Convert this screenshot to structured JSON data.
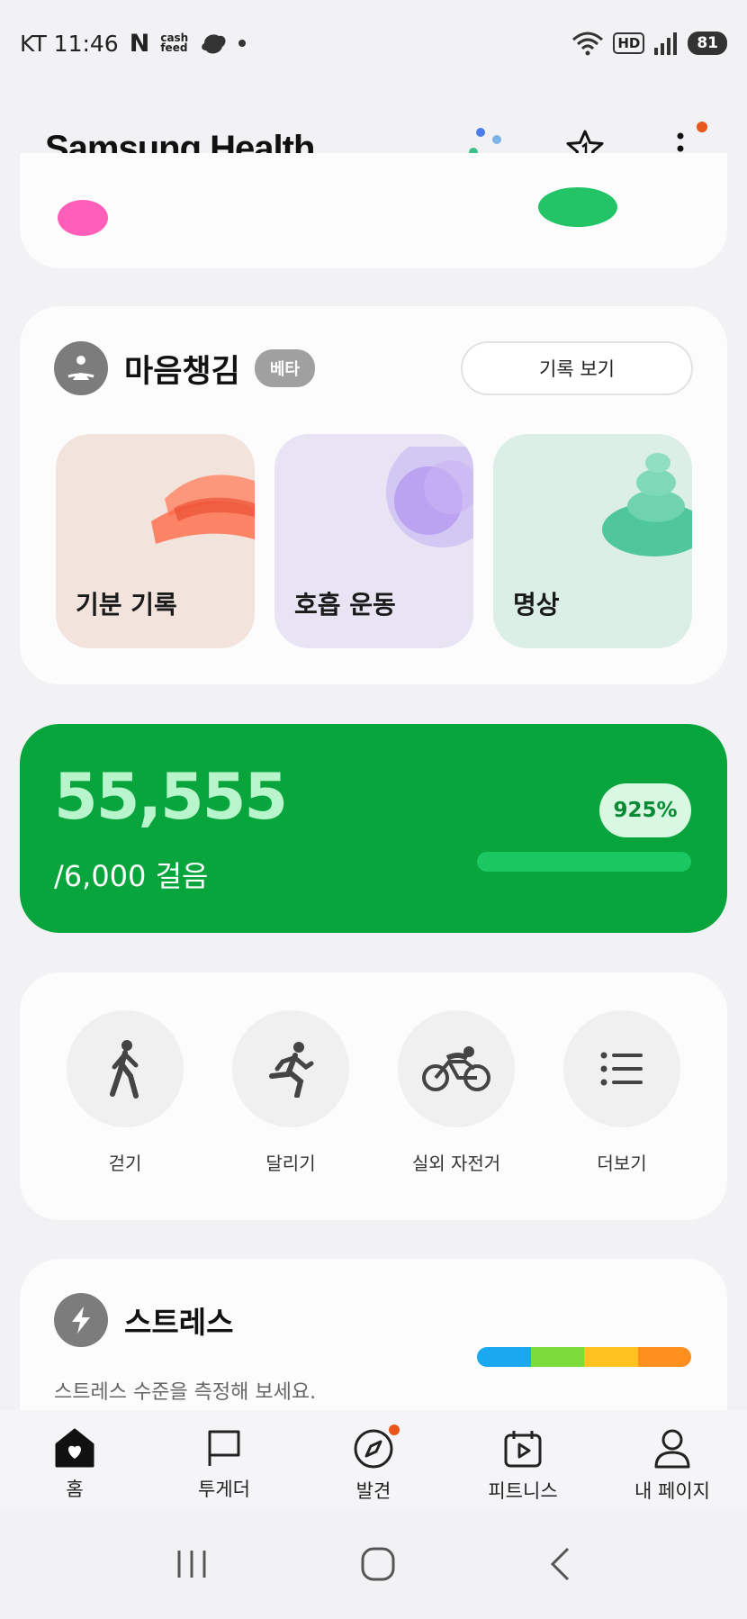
{
  "status_bar": {
    "carrier_time": "KT 11:46",
    "n_logo": "N",
    "cashfeed_top": "cash",
    "cashfeed_bottom": "feed",
    "hd": "HD",
    "battery": "81"
  },
  "app": {
    "title": "Samsung Health"
  },
  "mindfulness": {
    "title": "마음챙김",
    "badge": "베타",
    "records_button": "기록 보기",
    "tiles": [
      {
        "label": "기분 기록"
      },
      {
        "label": "호흡 운동"
      },
      {
        "label": "명상"
      }
    ]
  },
  "steps": {
    "count": "55,555",
    "goal": "/6,000 걸음",
    "percent_label": "925%",
    "progress": 1.0
  },
  "workouts": [
    {
      "label": "걷기",
      "icon": "walk-icon"
    },
    {
      "label": "달리기",
      "icon": "run-icon"
    },
    {
      "label": "실외 자전거",
      "icon": "bike-icon"
    },
    {
      "label": "더보기",
      "icon": "list-icon"
    }
  ],
  "stress": {
    "title": "스트레스",
    "subtitle": "스트레스 수준을 측정해 보세요.",
    "scale_colors": [
      "#1aa9f0",
      "#7ddc3a",
      "#ffc21f",
      "#ff8f1f"
    ]
  },
  "bottom_nav": [
    {
      "label": "홈",
      "icon": "home-icon",
      "active": true
    },
    {
      "label": "투게더",
      "icon": "flag-icon"
    },
    {
      "label": "발견",
      "icon": "compass-icon"
    },
    {
      "label": "피트니스",
      "icon": "play-calendar-icon"
    },
    {
      "label": "내 페이지",
      "icon": "person-icon"
    }
  ],
  "colors": {
    "steps_card": "#08a53d",
    "accent_orange": "#e8571b"
  }
}
